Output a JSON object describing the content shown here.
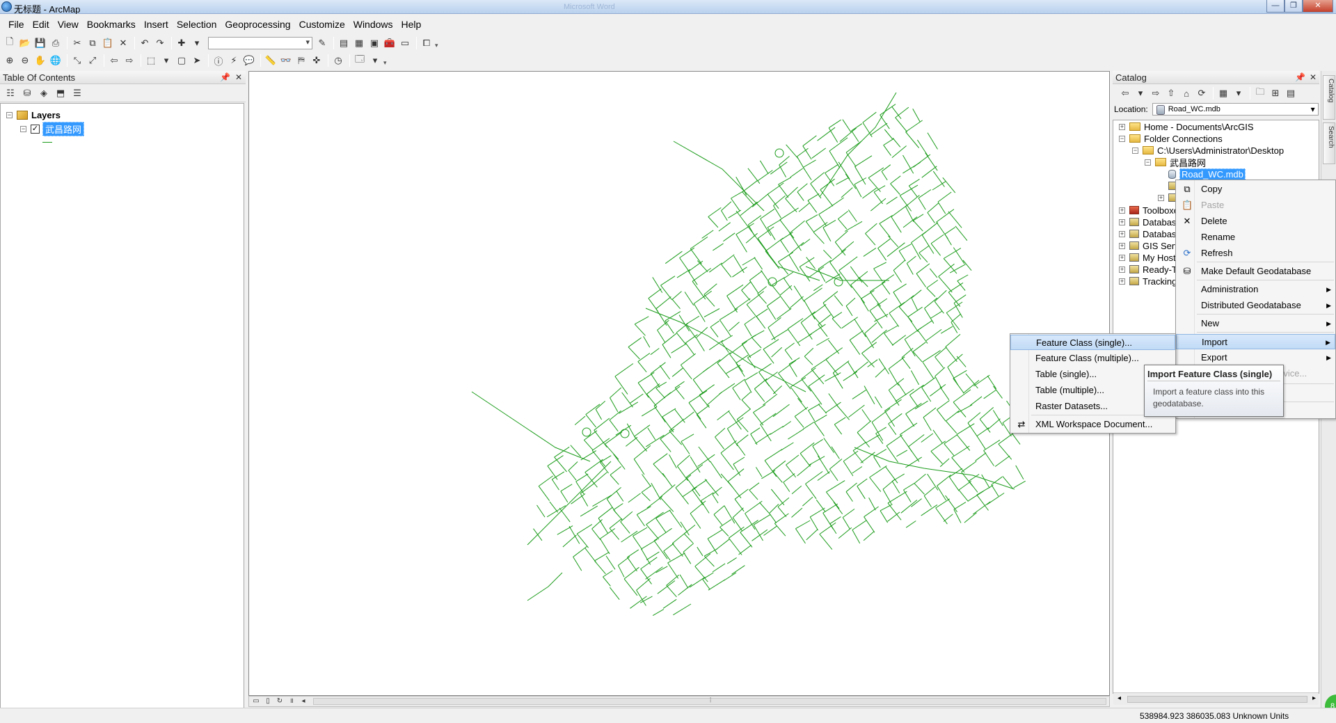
{
  "window": {
    "title": "无标题 - ArcMap",
    "blurred_title": "Microsoft Word"
  },
  "menu": [
    "File",
    "Edit",
    "View",
    "Bookmarks",
    "Insert",
    "Selection",
    "Geoprocessing",
    "Customize",
    "Windows",
    "Help"
  ],
  "toc": {
    "title": "Table Of Contents",
    "root": "Layers",
    "layer": "武昌路网"
  },
  "catalog": {
    "title": "Catalog",
    "location_label": "Location:",
    "location_value": "Road_WC.mdb",
    "tree": {
      "home": "Home - Documents\\ArcGIS",
      "folder_connections": "Folder Connections",
      "desktop": "C:\\Users\\Administrator\\Desktop",
      "subfolder": "武昌路网",
      "mdb": "Road_WC.mdb",
      "toolboxes": "Toolboxes",
      "database_servers": "Database Servers",
      "database_connections": "Database Connections",
      "gis_servers": "GIS Servers",
      "my_hosted": "My Hosted Services",
      "ready_to_use": "Ready-To-Use Services",
      "tracking": "Tracking Connections"
    },
    "tabs": [
      "Catalog",
      "Search"
    ]
  },
  "context_menu": {
    "copy": "Copy",
    "paste": "Paste",
    "delete": "Delete",
    "rename": "Rename",
    "refresh": "Refresh",
    "make_default": "Make Default Geodatabase",
    "administration": "Administration",
    "distributed": "Distributed Geodatabase",
    "new": "New",
    "import": "Import",
    "export": "Export",
    "hidden_partial": "rvice..."
  },
  "import_submenu": {
    "fc_single": "Feature Class (single)...",
    "fc_multiple": "Feature Class (multiple)...",
    "table_single": "Table (single)...",
    "table_multiple": "Table (multiple)...",
    "raster": "Raster Datasets...",
    "xml": "XML Workspace Document..."
  },
  "tooltip": {
    "title": "Import Feature Class (single)",
    "body": "Import a feature class into this geodatabase."
  },
  "status": {
    "coords": "538984.923  386035.083 Unknown Units"
  },
  "colors": {
    "road": "#1a9b1a",
    "selection": "#3399ff"
  }
}
